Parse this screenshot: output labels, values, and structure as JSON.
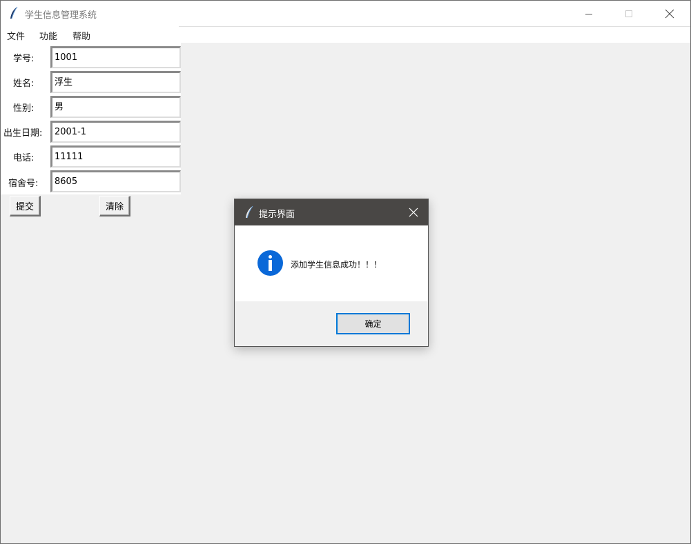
{
  "window": {
    "title": "学生信息管理系统",
    "icon": "feather-icon"
  },
  "menubar": {
    "items": [
      {
        "label": "文件"
      },
      {
        "label": "功能"
      },
      {
        "label": "帮助"
      }
    ]
  },
  "form": {
    "fields": [
      {
        "label": "学号:",
        "value": "1001"
      },
      {
        "label": "姓名:",
        "value": "浮生"
      },
      {
        "label": "性别:",
        "value": "男"
      },
      {
        "label": "出生日期:",
        "value": "2001-1"
      },
      {
        "label": "电话:",
        "value": "11111"
      },
      {
        "label": "宿舍号:",
        "value": "8605"
      }
    ],
    "submit_label": "提交",
    "clear_label": "清除"
  },
  "dialog": {
    "title": "提示界面",
    "icon": "info-icon",
    "message": "添加学生信息成功！！！",
    "ok_label": "确定"
  },
  "colors": {
    "dialog_title_bg": "#494745",
    "info_blue": "#0a68d8",
    "ok_border": "#0078d7"
  }
}
